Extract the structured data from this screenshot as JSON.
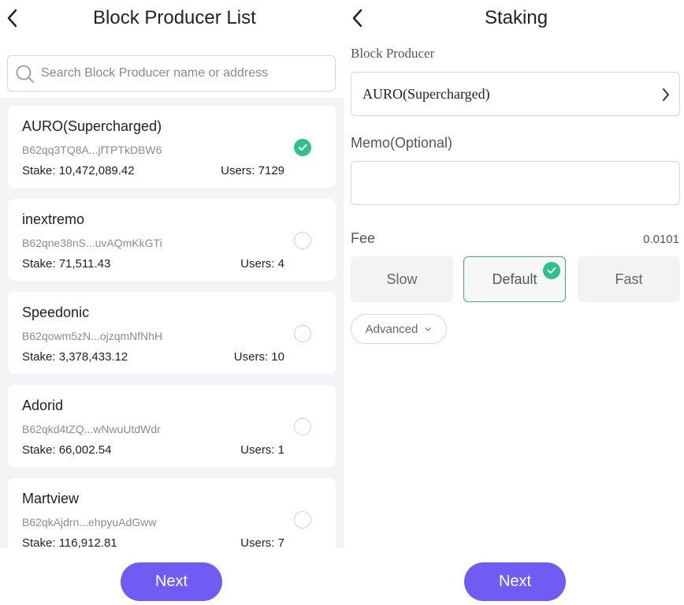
{
  "left_panel": {
    "title": "Block Producer List",
    "search_placeholder": "Search Block Producer name or address",
    "producers": [
      {
        "name": "AURO(Supercharged)",
        "address": "B62qq3TQ8A...jfTPTkDBW6",
        "stake": "Stake: 10,472,089.42",
        "users": "Users: 7129",
        "selected": true
      },
      {
        "name": "inextremo",
        "address": "B62qne38nS...uvAQmKkGTi",
        "stake": "Stake: 71,511.43",
        "users": "Users: 4",
        "selected": false
      },
      {
        "name": "Speedonic",
        "address": "B62qowm5zN...ojzqmNfNhH",
        "stake": "Stake: 3,378,433.12",
        "users": "Users: 10",
        "selected": false
      },
      {
        "name": "Adorid",
        "address": "B62qkd4tZQ...wNwuUtdWdr",
        "stake": "Stake: 66,002.54",
        "users": "Users: 1",
        "selected": false
      },
      {
        "name": "Martview",
        "address": "B62qkAjdrn...ehpyuAdGww",
        "stake": "Stake: 116,912.81",
        "users": "Users: 7",
        "selected": false
      }
    ],
    "next_label": "Next"
  },
  "right_panel": {
    "title": "Staking",
    "block_producer_label": "Block Producer",
    "block_producer_value": "AURO(Supercharged)",
    "memo_label": "Memo(Optional)",
    "fee_label": "Fee",
    "fee_value": "0.0101",
    "fee_options": [
      "Slow",
      "Default",
      "Fast"
    ],
    "fee_selected": "Default",
    "advanced_label": "Advanced",
    "next_label": "Next"
  },
  "colors": {
    "accent": "#6f5cf2",
    "check": "#2ebf8f",
    "selected_border": "#4aa88a"
  }
}
